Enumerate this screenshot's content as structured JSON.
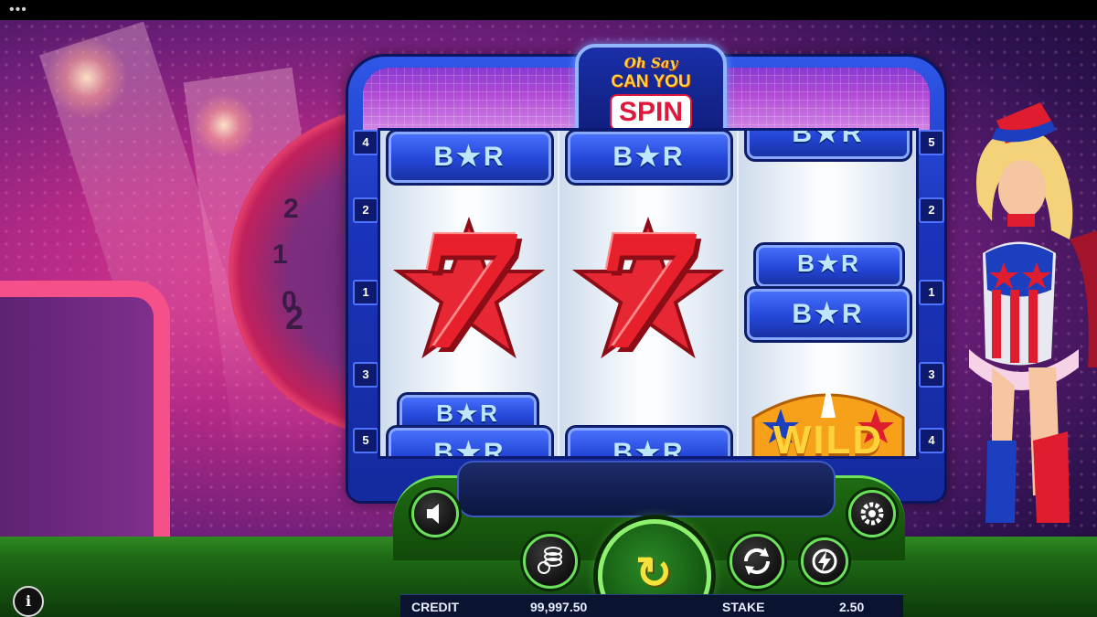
{
  "window": {
    "menu_dots": "•••"
  },
  "logo": {
    "line1": "Oh Say",
    "line2": "CAN YOU",
    "line3": "SPIN"
  },
  "paylines": {
    "left": [
      "4",
      "2",
      "1",
      "3",
      "5"
    ],
    "right": [
      "5",
      "2",
      "1",
      "3",
      "4"
    ]
  },
  "reels": {
    "reel1": [
      "BAR",
      "7",
      "BAR",
      "BAR"
    ],
    "reel2": [
      "BAR",
      "7",
      "BAR"
    ],
    "reel3": [
      "BAR",
      "BAR",
      "BAR",
      "WILD"
    ]
  },
  "symbols": {
    "bar": "B★R",
    "seven": "7",
    "wild": "WILD"
  },
  "wheel_numbers": [
    "2",
    "1",
    "0",
    "2"
  ],
  "footer": {
    "credit_label": "CREDIT",
    "credit_value": "99,997.50",
    "stake_label": "STAKE",
    "stake_value": "2.50"
  },
  "icons": {
    "sound": "speaker-icon",
    "settings": "gear-icon",
    "bet": "coin-stack-icon",
    "autoplay": "autoplay-icon",
    "turbo": "lightning-icon",
    "spin": "spin-arrow-icon",
    "info": "info-icon"
  },
  "info_glyph": "i",
  "colors": {
    "accent_green": "#6be05a",
    "cabinet_blue": "#1a33b9",
    "seven_red": "#e7202c",
    "wild_gold": "#ffd33b"
  }
}
